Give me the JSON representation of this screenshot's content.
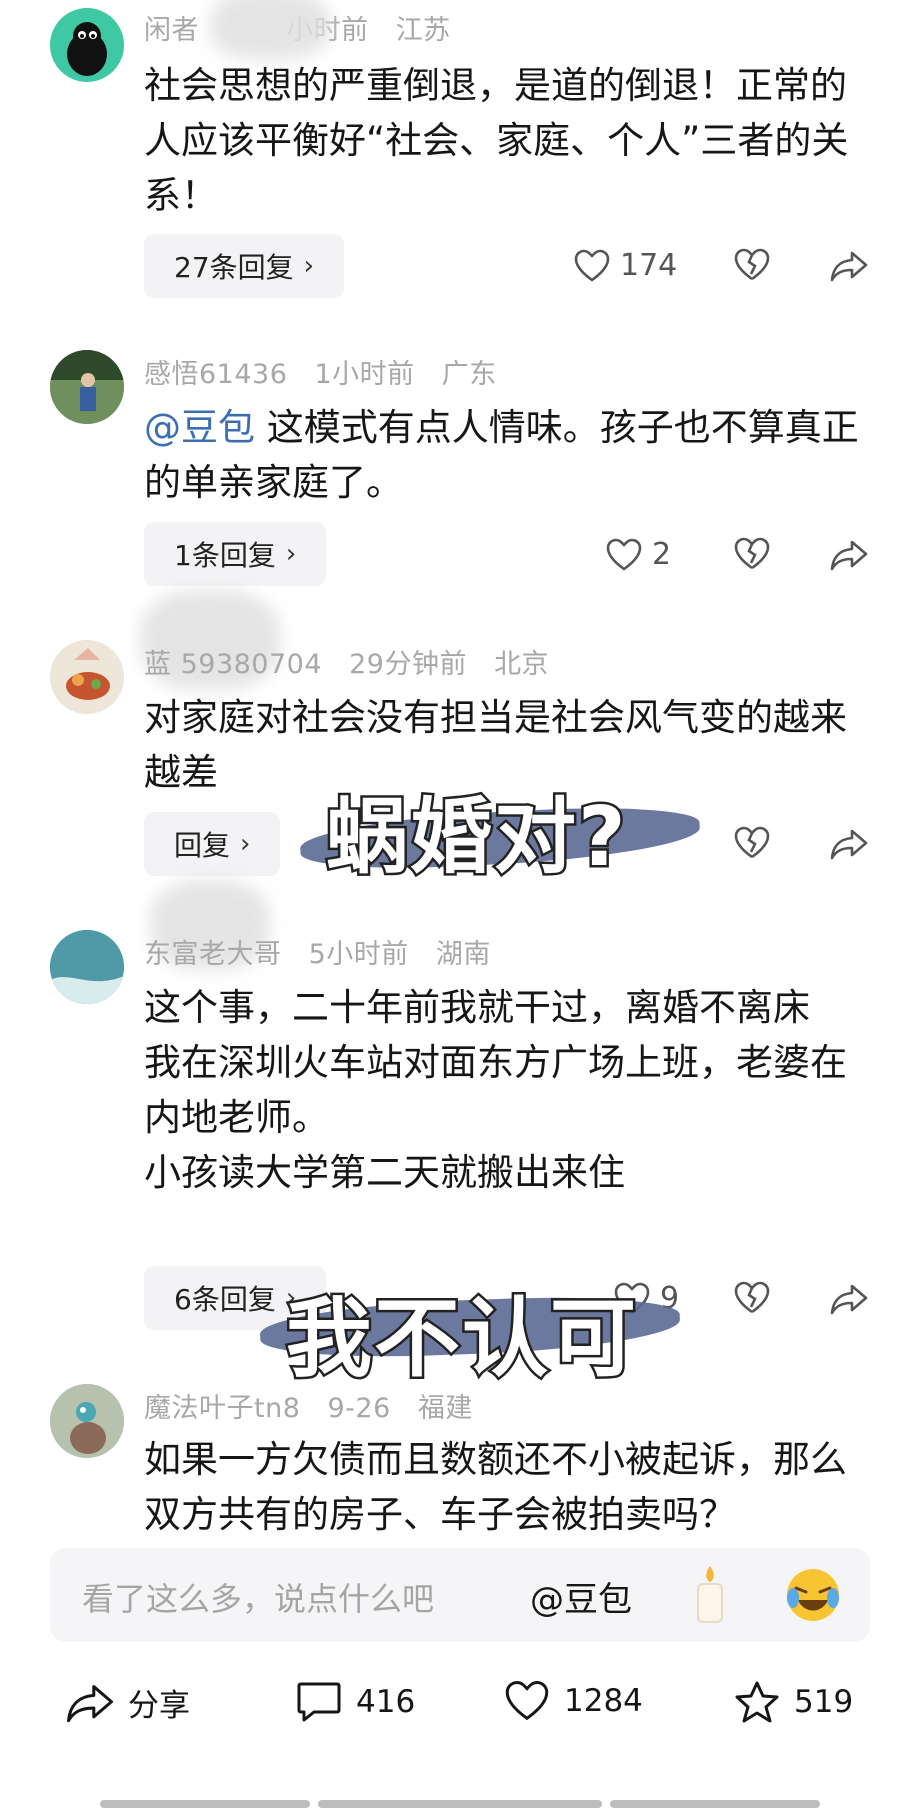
{
  "comments": [
    {
      "username": "闲者",
      "time": "小时前",
      "location": "江苏",
      "lines": [
        "社会思想的严重倒退，是道的倒退！正常的人应该平衡好“社会、家庭、个人”三者的关系！"
      ],
      "reply_label": "27条回复",
      "likes": "174"
    },
    {
      "username": "感悟61436",
      "time": "1小时前",
      "location": "广东",
      "mention": "@豆包",
      "lines": [
        " 这模式有点人情味。孩子也不算真正的单亲家庭了。"
      ],
      "reply_label": "1条回复",
      "likes": "2"
    },
    {
      "username": "蓝  59380704",
      "time": "29分钟前",
      "location": "北京",
      "lines": [
        "对家庭对社会没有担当是社会风气变的越来越差"
      ],
      "reply_label": "回复",
      "likes": ""
    },
    {
      "username": "东富老大哥",
      "time": "5小时前",
      "location": "湖南",
      "lines": [
        "这个事，二十年前我就干过，离婚不离床",
        "我在深圳火车站对面东方广场上班，老婆在内地老师。",
        "小孩读大学第二天就搬出来住"
      ],
      "reply_label": "6条回复",
      "likes": "9"
    },
    {
      "username": "魔法叶子tn8",
      "time": "9-26",
      "location": "福建",
      "lines": [
        "如果一方欠债而且数额还不小被起诉，那么双方共有的房子、车子会被拍卖吗？"
      ]
    }
  ],
  "overlays": {
    "caption1": "蜗婚对?",
    "caption2": "我不认可"
  },
  "input": {
    "placeholder": "看了这么多，说点什么吧",
    "mention": "@豆包"
  },
  "bottom_bar": {
    "share_label": "分享",
    "comments_count": "416",
    "likes_count": "1284",
    "favorites_count": "519"
  },
  "icons": {
    "like": "heart-outline-icon",
    "dislike": "broken-heart-icon",
    "share": "share-arrow-icon",
    "candle": "candle-emoji-icon",
    "laugh": "laughing-emoji-icon"
  },
  "colors": {
    "mention": "#3c6fb0",
    "meta": "#a8a8a8",
    "brush": "#5c6a95"
  }
}
